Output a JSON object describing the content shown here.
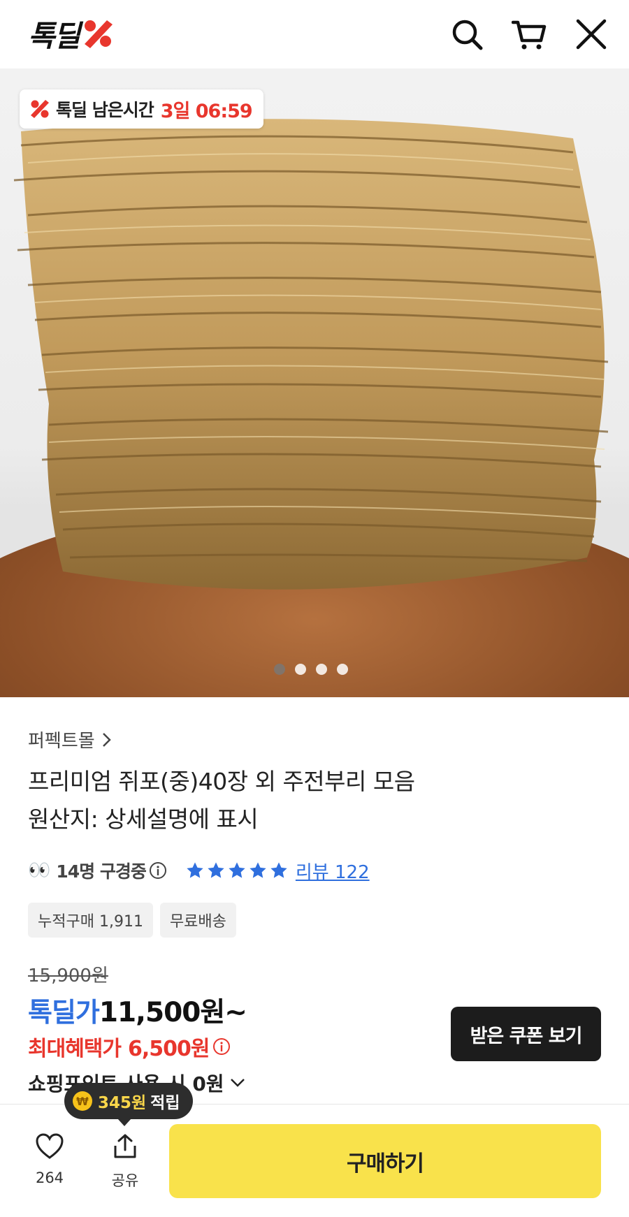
{
  "header": {
    "logo_text": "톡딜",
    "icons": [
      "search-icon",
      "cart-icon",
      "close-icon"
    ]
  },
  "hero": {
    "badge_label": "톡딜 남은시간",
    "badge_time": "3일 06:59",
    "image_count": 4,
    "active_index": 0
  },
  "product": {
    "store": "퍼펙트몰",
    "title_line1": "프리미엄 쥐포(중)40장 외 주전부리 모음",
    "title_line2": "원산지: 상세설명에 표시",
    "viewers": "14명 구경중",
    "rating": 5,
    "review_link": "리뷰 122",
    "chips": [
      "누적구매 1,911",
      "무료배송"
    ],
    "original_price": "15,900원",
    "deal_label": "톡딜가",
    "deal_price": "11,500원~",
    "max_benefit_label": "최대혜택가",
    "max_benefit_price": "6,500원",
    "points_text": "쇼핑포인트 사용 시 0원",
    "coupon_button": "받은 쿠폰 보기"
  },
  "bottom_bar": {
    "like_count": "264",
    "share_label": "공유",
    "buy_button": "구매하기",
    "tooltip_amount": "345원",
    "tooltip_label": "적립"
  },
  "colors": {
    "accent_blue": "#2f6fde",
    "accent_red": "#e8362d",
    "buy_yellow": "#f9e24b"
  }
}
